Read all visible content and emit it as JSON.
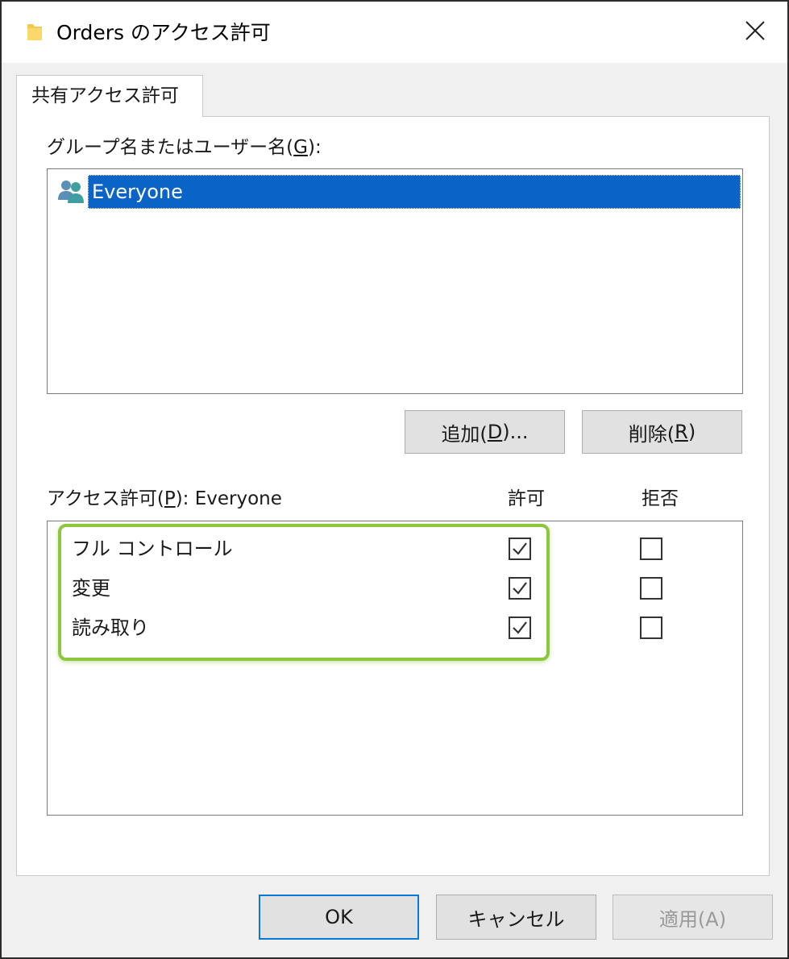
{
  "window": {
    "title": "Orders のアクセス許可",
    "folder_icon": "folder-icon",
    "close_icon": "close-icon"
  },
  "tab": {
    "label": "共有アクセス許可"
  },
  "groups": {
    "label_prefix": "グループ名またはユーザー名(",
    "label_key": "G",
    "label_suffix": "):",
    "items": [
      {
        "name": "Everyone",
        "icon": "users-icon",
        "selected": true
      }
    ]
  },
  "buttons": {
    "add": {
      "prefix": "追加(",
      "key": "D",
      "suffix": ")..."
    },
    "remove": {
      "prefix": "削除(",
      "key": "R",
      "suffix": ")"
    },
    "ok": "OK",
    "cancel": "キャンセル",
    "apply": "適用(A)"
  },
  "permissions": {
    "label_prefix": "アクセス許可(",
    "label_key": "P",
    "label_suffix": "): Everyone",
    "allow_header": "許可",
    "deny_header": "拒否",
    "rows": [
      {
        "name": "フル コントロール",
        "allow": true,
        "deny": false
      },
      {
        "name": "変更",
        "allow": true,
        "deny": false
      },
      {
        "name": "読み取り",
        "allow": true,
        "deny": false
      }
    ]
  },
  "colors": {
    "selection": "#0a64c8",
    "highlight_border": "#8dc63f",
    "default_button_border": "#0a78d7"
  }
}
